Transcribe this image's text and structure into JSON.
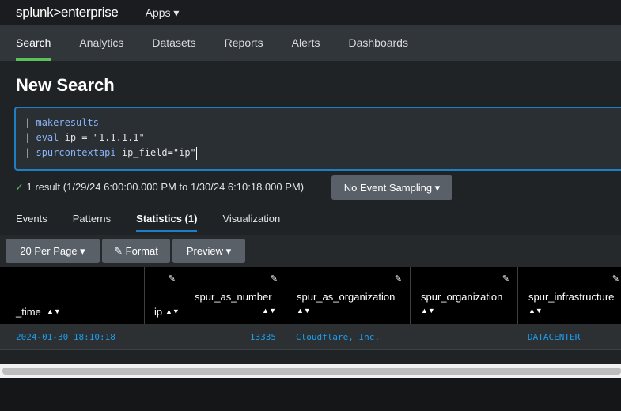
{
  "brand": {
    "logo_text": "splunk>enterprise"
  },
  "topbar": {
    "apps_label": "Apps ▾"
  },
  "nav": {
    "tabs": [
      {
        "label": "Search"
      },
      {
        "label": "Analytics"
      },
      {
        "label": "Datasets"
      },
      {
        "label": "Reports"
      },
      {
        "label": "Alerts"
      },
      {
        "label": "Dashboards"
      }
    ]
  },
  "page": {
    "title": "New Search"
  },
  "search": {
    "lines": [
      {
        "pipe": "|",
        "cmd": "makeresults",
        "args": ""
      },
      {
        "pipe": "|",
        "cmd": "eval",
        "args": " ip = \"1.1.1.1\""
      },
      {
        "pipe": "|",
        "cmd": "spurcontextapi",
        "args": " ip_field=\"ip\""
      }
    ]
  },
  "status": {
    "check": "✓",
    "text": "1 result (1/29/24 6:00:00.000 PM to 1/30/24 6:10:18.000 PM)",
    "sampling_label": "No Event Sampling ▾"
  },
  "result_tabs": [
    {
      "label": "Events"
    },
    {
      "label": "Patterns"
    },
    {
      "label": "Statistics (1)"
    },
    {
      "label": "Visualization"
    }
  ],
  "toolbar": {
    "per_page": "20 Per Page ▾",
    "format": "✎ Format",
    "preview": "Preview ▾"
  },
  "table": {
    "columns": [
      "_time",
      "ip",
      "spur_as_number",
      "spur_as_organization",
      "spur_organization",
      "spur_infrastructure"
    ],
    "rows": [
      {
        "_time": "2024-01-30 18:10:18",
        "ip": "",
        "spur_as_number": "13335",
        "spur_as_organization": "Cloudflare, Inc.",
        "spur_organization": "",
        "spur_infrastructure": "DATACENTER"
      }
    ]
  },
  "colors": {
    "accent_green": "#5cc05c",
    "accent_blue": "#1e7fc2",
    "link_blue": "#1a9ff0"
  }
}
